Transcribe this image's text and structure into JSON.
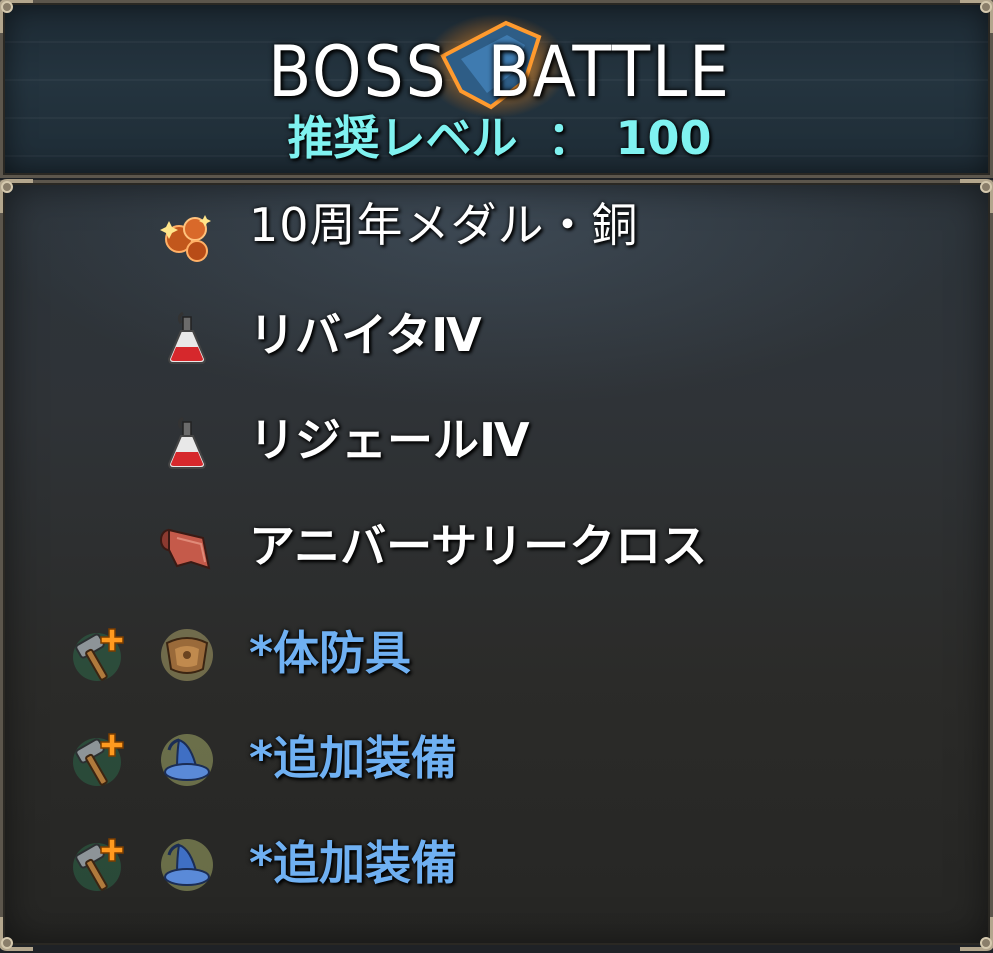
{
  "header": {
    "title": "BOSS BATTLE",
    "level_label": "推奨レベル",
    "level_separator": "：",
    "level_value": "100"
  },
  "rewards": [
    {
      "label": "10周年メダル・銅",
      "icon": "medal-icon",
      "type": "item"
    },
    {
      "label": "リバイタⅣ",
      "icon": "potion-icon",
      "type": "item"
    },
    {
      "label": "リジェールⅣ",
      "icon": "potion-icon",
      "type": "item"
    },
    {
      "label": "アニバーサリークロス",
      "icon": "cloth-icon",
      "type": "item"
    },
    {
      "label": "*体防具",
      "icon": "body-armor-icon",
      "type": "equipment",
      "craft_icon": "hammer-plus-icon"
    },
    {
      "label": "*追加装備",
      "icon": "wizard-hat-icon",
      "type": "equipment",
      "craft_icon": "hammer-plus-icon"
    },
    {
      "label": "*追加装備",
      "icon": "wizard-hat-icon",
      "type": "equipment",
      "craft_icon": "hammer-plus-icon"
    }
  ],
  "colors": {
    "title": "#ffffff",
    "level": "#7ff2f0",
    "item_text": "#ffffff",
    "equipment_text": "#6fb0f2",
    "frame": "#5c564c"
  }
}
